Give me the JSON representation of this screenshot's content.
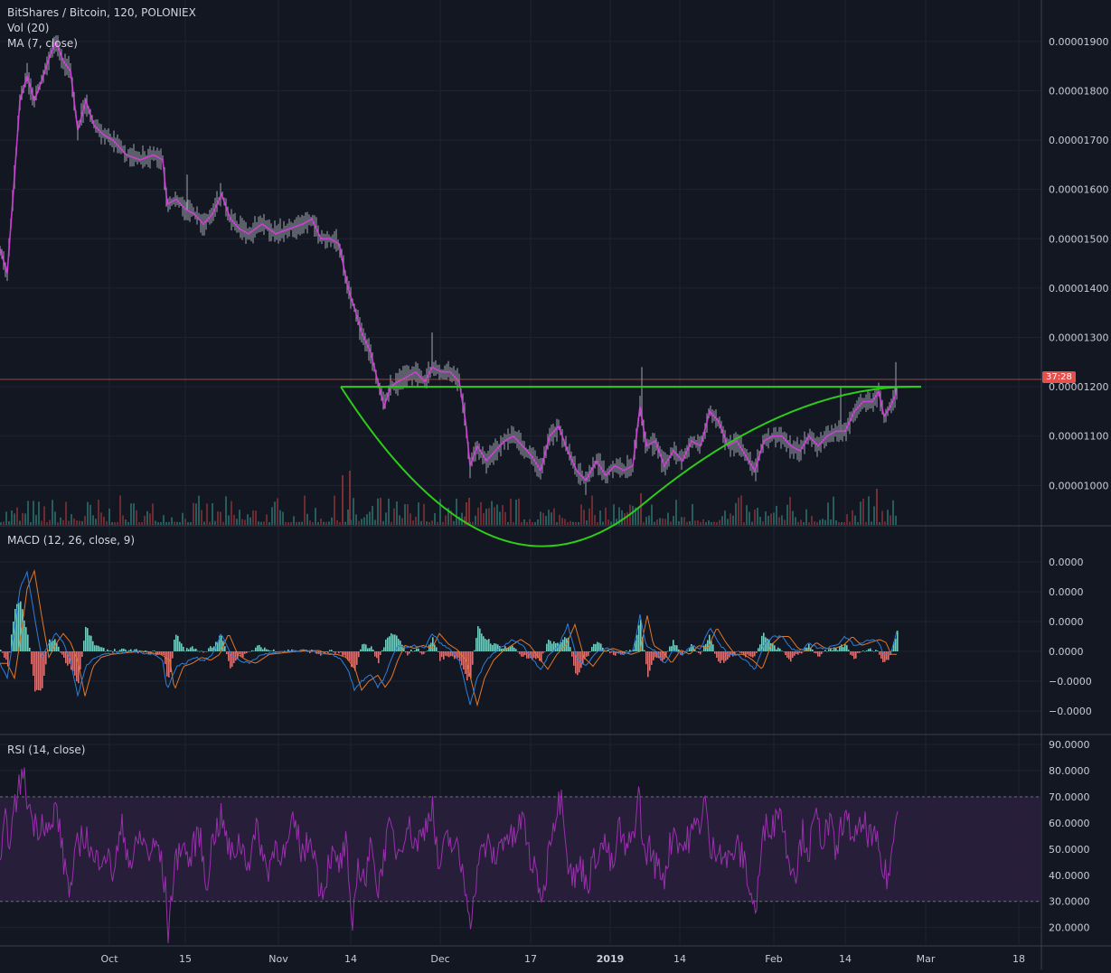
{
  "legend": {
    "symbol": "BitShares / Bitcoin, 120, POLONIEX",
    "volume": "Vol (20)",
    "ma": "MA (7, close)",
    "macd": "MACD (12, 26, close, 9)",
    "rsi": "RSI (14, close)"
  },
  "countdown_label": "37:28",
  "colors": {
    "background": "#131722",
    "grid": "#1f2330",
    "candle": "#8b8f9a",
    "ma": "#d93de0",
    "pattern": "#2ecc1a",
    "last_price_line": "#e05252",
    "countdown_bg": "#e5504c",
    "macd_line": "#2e7fd9",
    "signal_line": "#e27728",
    "hist_pos": "#7fe0d2",
    "hist_neg": "#f07a7a",
    "rsi_line": "#9b2fae",
    "rsi_band": "#2a1f3d"
  },
  "chart_data": [
    {
      "type": "line",
      "panel": "price",
      "x_ticks": [
        "Oct",
        "15",
        "Nov",
        "14",
        "Dec",
        "17",
        "2019",
        "14",
        "Feb",
        "14",
        "Mar",
        "18"
      ],
      "y_ticks": [
        "0.00001900",
        "0.00001800",
        "0.00001700",
        "0.00001600",
        "0.00001500",
        "0.00001400",
        "0.00001300",
        "0.00001200",
        "0.00001100",
        "0.00001000"
      ],
      "ylim": [
        9.2e-06,
        1.984e-05
      ],
      "last_price": 1.215e-05,
      "price_points": [
        [
          0,
          1.48e-05
        ],
        [
          8,
          1.43e-05
        ],
        [
          15,
          1.6e-05
        ],
        [
          22,
          1.78e-05
        ],
        [
          30,
          1.83e-05
        ],
        [
          38,
          1.78e-05
        ],
        [
          46,
          1.82e-05
        ],
        [
          55,
          1.87e-05
        ],
        [
          62,
          1.9e-05
        ],
        [
          70,
          1.86e-05
        ],
        [
          78,
          1.84e-05
        ],
        [
          86,
          1.72e-05
        ],
        [
          95,
          1.78e-05
        ],
        [
          104,
          1.73e-05
        ],
        [
          115,
          1.71e-05
        ],
        [
          125,
          1.7e-05
        ],
        [
          140,
          1.67e-05
        ],
        [
          155,
          1.66e-05
        ],
        [
          170,
          1.67e-05
        ],
        [
          180,
          1.66e-05
        ],
        [
          185,
          1.57e-05
        ],
        [
          195,
          1.58e-05
        ],
        [
          205,
          1.56e-05
        ],
        [
          215,
          1.55e-05
        ],
        [
          225,
          1.53e-05
        ],
        [
          235,
          1.55e-05
        ],
        [
          245,
          1.59e-05
        ],
        [
          255,
          1.54e-05
        ],
        [
          265,
          1.52e-05
        ],
        [
          275,
          1.51e-05
        ],
        [
          290,
          1.53e-05
        ],
        [
          305,
          1.51e-05
        ],
        [
          320,
          1.52e-05
        ],
        [
          335,
          1.53e-05
        ],
        [
          345,
          1.54e-05
        ],
        [
          355,
          1.5e-05
        ],
        [
          365,
          1.5e-05
        ],
        [
          375,
          1.49e-05
        ],
        [
          385,
          1.4e-05
        ],
        [
          392,
          1.36e-05
        ],
        [
          400,
          1.31e-05
        ],
        [
          410,
          1.27e-05
        ],
        [
          418,
          1.21e-05
        ],
        [
          425,
          1.16e-05
        ],
        [
          432,
          1.2e-05
        ],
        [
          440,
          1.21e-05
        ],
        [
          450,
          1.22e-05
        ],
        [
          460,
          1.23e-05
        ],
        [
          470,
          1.21e-05
        ],
        [
          478,
          1.24e-05
        ],
        [
          488,
          1.23e-05
        ],
        [
          498,
          1.23e-05
        ],
        [
          508,
          1.21e-05
        ],
        [
          515,
          1.13e-05
        ],
        [
          520,
          1.04e-05
        ],
        [
          528,
          1.08e-05
        ],
        [
          538,
          1.05e-05
        ],
        [
          548,
          1.07e-05
        ],
        [
          558,
          1.09e-05
        ],
        [
          568,
          1.1e-05
        ],
        [
          578,
          1.08e-05
        ],
        [
          588,
          1.06e-05
        ],
        [
          598,
          1.03e-05
        ],
        [
          608,
          1.1e-05
        ],
        [
          618,
          1.12e-05
        ],
        [
          628,
          1.07e-05
        ],
        [
          638,
          1.03e-05
        ],
        [
          648,
          1.01e-05
        ],
        [
          660,
          1.05e-05
        ],
        [
          670,
          1.02e-05
        ],
        [
          680,
          1.04e-05
        ],
        [
          690,
          1.03e-05
        ],
        [
          700,
          1.04e-05
        ],
        [
          708,
          1.16e-05
        ],
        [
          715,
          1.08e-05
        ],
        [
          725,
          1.09e-05
        ],
        [
          735,
          1.04e-05
        ],
        [
          745,
          1.07e-05
        ],
        [
          755,
          1.05e-05
        ],
        [
          765,
          1.09e-05
        ],
        [
          775,
          1.08e-05
        ],
        [
          785,
          1.15e-05
        ],
        [
          795,
          1.13e-05
        ],
        [
          805,
          1.08e-05
        ],
        [
          815,
          1.09e-05
        ],
        [
          825,
          1.06e-05
        ],
        [
          835,
          1.03e-05
        ],
        [
          845,
          1.09e-05
        ],
        [
          855,
          1.1e-05
        ],
        [
          865,
          1.1e-05
        ],
        [
          875,
          1.08e-05
        ],
        [
          885,
          1.07e-05
        ],
        [
          895,
          1.1e-05
        ],
        [
          905,
          1.08e-05
        ],
        [
          915,
          1.1e-05
        ],
        [
          925,
          1.11e-05
        ],
        [
          935,
          1.11e-05
        ],
        [
          945,
          1.15e-05
        ],
        [
          955,
          1.17e-05
        ],
        [
          965,
          1.17e-05
        ],
        [
          972,
          1.19e-05
        ],
        [
          978,
          1.14e-05
        ],
        [
          985,
          1.16e-05
        ],
        [
          992,
          1.19e-05
        ]
      ],
      "pattern_rim_price": 1.2e-05,
      "pattern_bottom_price": 9.6e-06
    },
    {
      "type": "line",
      "panel": "macd",
      "series": [
        {
          "name": "MACD",
          "role": "macd"
        },
        {
          "name": "Signal",
          "role": "signal"
        },
        {
          "name": "Histogram",
          "role": "histogram"
        }
      ],
      "y_ticks": [
        "0.0000",
        "0.0000",
        "0.0000",
        "0.0000",
        "−0.0000",
        "−0.0000"
      ],
      "macd_points": [
        [
          0,
          -0.4
        ],
        [
          8,
          -0.9
        ],
        [
          15,
          0.5
        ],
        [
          22,
          2.1
        ],
        [
          30,
          2.7
        ],
        [
          38,
          1.2
        ],
        [
          46,
          -0.2
        ],
        [
          55,
          0.3
        ],
        [
          62,
          0.6
        ],
        [
          70,
          0.3
        ],
        [
          78,
          -0.3
        ],
        [
          86,
          -1.5
        ],
        [
          95,
          -0.5
        ],
        [
          104,
          -0.2
        ],
        [
          115,
          -0.1
        ],
        [
          130,
          -0.05
        ],
        [
          150,
          0.0
        ],
        [
          170,
          -0.1
        ],
        [
          180,
          -0.3
        ],
        [
          185,
          -1.3
        ],
        [
          195,
          -0.5
        ],
        [
          205,
          -0.4
        ],
        [
          215,
          -0.2
        ],
        [
          225,
          -0.3
        ],
        [
          235,
          -0.1
        ],
        [
          245,
          0.6
        ],
        [
          255,
          -0.1
        ],
        [
          265,
          -0.3
        ],
        [
          275,
          -0.4
        ],
        [
          290,
          -0.1
        ],
        [
          305,
          -0.05
        ],
        [
          320,
          0.0
        ],
        [
          335,
          0.02
        ],
        [
          345,
          0.03
        ],
        [
          355,
          -0.1
        ],
        [
          365,
          -0.1
        ],
        [
          375,
          -0.2
        ],
        [
          385,
          -0.6
        ],
        [
          392,
          -1.3
        ],
        [
          400,
          -1.0
        ],
        [
          410,
          -0.8
        ],
        [
          418,
          -1.2
        ],
        [
          425,
          -0.9
        ],
        [
          432,
          -0.3
        ],
        [
          440,
          0.2
        ],
        [
          450,
          0.1
        ],
        [
          460,
          0.2
        ],
        [
          470,
          0.1
        ],
        [
          478,
          0.6
        ],
        [
          488,
          0.25
        ],
        [
          498,
          0.05
        ],
        [
          508,
          -0.3
        ],
        [
          515,
          -1.2
        ],
        [
          520,
          -1.8
        ],
        [
          528,
          -0.9
        ],
        [
          538,
          -0.3
        ],
        [
          548,
          0.0
        ],
        [
          558,
          0.2
        ],
        [
          568,
          0.4
        ],
        [
          578,
          0.2
        ],
        [
          588,
          -0.2
        ],
        [
          598,
          -0.6
        ],
        [
          608,
          -0.1
        ],
        [
          618,
          0.2
        ],
        [
          628,
          0.9
        ],
        [
          638,
          -0.2
        ],
        [
          648,
          -0.5
        ],
        [
          660,
          0.0
        ],
        [
          670,
          0.1
        ],
        [
          680,
          0.0
        ],
        [
          690,
          -0.1
        ],
        [
          700,
          0.0
        ],
        [
          708,
          1.2
        ],
        [
          715,
          0.2
        ],
        [
          725,
          0.0
        ],
        [
          735,
          -0.4
        ],
        [
          745,
          0.05
        ],
        [
          755,
          -0.1
        ],
        [
          765,
          0.2
        ],
        [
          775,
          0.1
        ],
        [
          785,
          0.8
        ],
        [
          795,
          0.3
        ],
        [
          805,
          -0.1
        ],
        [
          815,
          -0.1
        ],
        [
          825,
          -0.3
        ],
        [
          835,
          -0.6
        ],
        [
          845,
          0.2
        ],
        [
          855,
          0.5
        ],
        [
          865,
          0.5
        ],
        [
          875,
          0.1
        ],
        [
          885,
          0.0
        ],
        [
          895,
          0.3
        ],
        [
          905,
          0.1
        ],
        [
          915,
          0.1
        ],
        [
          925,
          0.2
        ],
        [
          935,
          0.5
        ],
        [
          945,
          0.2
        ],
        [
          955,
          0.3
        ],
        [
          965,
          0.4
        ],
        [
          972,
          0.3
        ],
        [
          978,
          -0.1
        ],
        [
          985,
          -0.1
        ],
        [
          992,
          0.65
        ]
      ],
      "signal_lag": 3
    },
    {
      "type": "line",
      "panel": "rsi",
      "y_ticks": [
        "90.0000",
        "80.0000",
        "70.0000",
        "60.0000",
        "50.0000",
        "40.0000",
        "30.0000",
        "20.0000"
      ],
      "ylim": [
        13.3,
        93.5
      ],
      "band": [
        30,
        70
      ],
      "rsi_points": [
        [
          0,
          42
        ],
        [
          6,
          60
        ],
        [
          12,
          54
        ],
        [
          20,
          74
        ],
        [
          26,
          78
        ],
        [
          32,
          66
        ],
        [
          40,
          58
        ],
        [
          48,
          62
        ],
        [
          56,
          55
        ],
        [
          62,
          68
        ],
        [
          70,
          46
        ],
        [
          78,
          34
        ],
        [
          86,
          52
        ],
        [
          95,
          56
        ],
        [
          104,
          44
        ],
        [
          115,
          50
        ],
        [
          125,
          41
        ],
        [
          135,
          58
        ],
        [
          145,
          44
        ],
        [
          155,
          55
        ],
        [
          165,
          48
        ],
        [
          175,
          52
        ],
        [
          183,
          34
        ],
        [
          186,
          18
        ],
        [
          192,
          40
        ],
        [
          200,
          53
        ],
        [
          210,
          45
        ],
        [
          220,
          58
        ],
        [
          228,
          36
        ],
        [
          236,
          55
        ],
        [
          245,
          62
        ],
        [
          255,
          47
        ],
        [
          265,
          53
        ],
        [
          275,
          45
        ],
        [
          285,
          58
        ],
        [
          295,
          41
        ],
        [
          305,
          52
        ],
        [
          315,
          47
        ],
        [
          325,
          60
        ],
        [
          335,
          48
        ],
        [
          345,
          55
        ],
        [
          352,
          38
        ],
        [
          358,
          34
        ],
        [
          365,
          48
        ],
        [
          375,
          43
        ],
        [
          383,
          52
        ],
        [
          389,
          16
        ],
        [
          395,
          44
        ],
        [
          405,
          38
        ],
        [
          412,
          55
        ],
        [
          418,
          32
        ],
        [
          425,
          50
        ],
        [
          432,
          58
        ],
        [
          440,
          48
        ],
        [
          450,
          60
        ],
        [
          460,
          52
        ],
        [
          468,
          56
        ],
        [
          478,
          68
        ],
        [
          485,
          42
        ],
        [
          495,
          54
        ],
        [
          505,
          50
        ],
        [
          512,
          41
        ],
        [
          518,
          30
        ],
        [
          522,
          22
        ],
        [
          528,
          44
        ],
        [
          538,
          52
        ],
        [
          548,
          46
        ],
        [
          558,
          56
        ],
        [
          568,
          53
        ],
        [
          578,
          62
        ],
        [
          588,
          44
        ],
        [
          595,
          38
        ],
        [
          601,
          30
        ],
        [
          608,
          55
        ],
        [
          615,
          64
        ],
        [
          622,
          72
        ],
        [
          628,
          46
        ],
        [
          635,
          38
        ],
        [
          642,
          44
        ],
        [
          650,
          37
        ],
        [
          660,
          49
        ],
        [
          670,
          52
        ],
        [
          678,
          41
        ],
        [
          685,
          59
        ],
        [
          692,
          48
        ],
        [
          700,
          55
        ],
        [
          707,
          72
        ],
        [
          712,
          47
        ],
        [
          718,
          51
        ],
        [
          725,
          44
        ],
        [
          735,
          40
        ],
        [
          745,
          58
        ],
        [
          755,
          50
        ],
        [
          765,
          56
        ],
        [
          775,
          61
        ],
        [
          780,
          70
        ],
        [
          785,
          48
        ],
        [
          795,
          52
        ],
        [
          805,
          45
        ],
        [
          815,
          51
        ],
        [
          825,
          44
        ],
        [
          830,
          33
        ],
        [
          836,
          26
        ],
        [
          842,
          48
        ],
        [
          848,
          62
        ],
        [
          855,
          58
        ],
        [
          862,
          68
        ],
        [
          870,
          50
        ],
        [
          880,
          41
        ],
        [
          888,
          56
        ],
        [
          895,
          49
        ],
        [
          902,
          62
        ],
        [
          910,
          54
        ],
        [
          918,
          60
        ],
        [
          925,
          47
        ],
        [
          932,
          62
        ],
        [
          940,
          58
        ],
        [
          948,
          54
        ],
        [
          955,
          60
        ],
        [
          962,
          55
        ],
        [
          970,
          52
        ],
        [
          976,
          42
        ],
        [
          982,
          39
        ],
        [
          986,
          46
        ],
        [
          990,
          58
        ],
        [
          993,
          70
        ]
      ]
    }
  ]
}
